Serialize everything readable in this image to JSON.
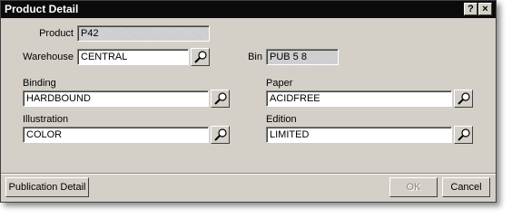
{
  "window": {
    "title": "Product Detail",
    "help_button": "?",
    "close_button": "×"
  },
  "form": {
    "product": {
      "label": "Product",
      "value": "P42"
    },
    "warehouse": {
      "label": "Warehouse",
      "value": "CENTRAL"
    },
    "bin": {
      "label": "Bin",
      "value": "PUB 5 8"
    },
    "binding": {
      "label": "Binding",
      "value": "HARDBOUND"
    },
    "paper": {
      "label": "Paper",
      "value": "ACIDFREE"
    },
    "illustration": {
      "label": "Illustration",
      "value": "COLOR"
    },
    "edition": {
      "label": "Edition",
      "value": "LIMITED"
    }
  },
  "footer": {
    "publication_detail": "Publication Detail",
    "ok": "OK",
    "cancel": "Cancel"
  },
  "colors": {
    "dialog_face": "#d4d0c8",
    "titlebar": "#0b0b0b",
    "readonly_field": "#c8c8c8"
  },
  "icons": {
    "lookup": "magnifier-icon",
    "help": "help-icon",
    "close": "close-icon"
  }
}
